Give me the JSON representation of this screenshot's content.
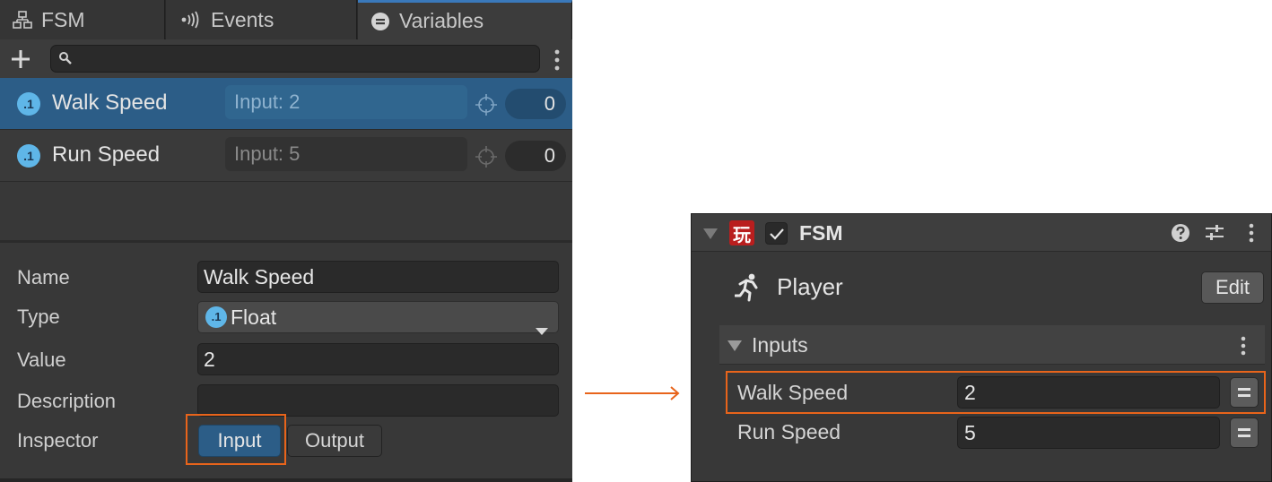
{
  "tabs": {
    "fsm": "FSM",
    "events": "Events",
    "variables": "Variables"
  },
  "search": {
    "value": "",
    "placeholder": ""
  },
  "variables": [
    {
      "name": "Walk Speed",
      "io": "Input: 2",
      "value": "0"
    },
    {
      "name": "Run Speed",
      "io": "Input: 5",
      "value": "0"
    }
  ],
  "float_badge": ".1",
  "properties": {
    "name_label": "Name",
    "name_value": "Walk Speed",
    "type_label": "Type",
    "type_value": "Float",
    "value_label": "Value",
    "value_value": "2",
    "description_label": "Description",
    "description_value": "",
    "inspector_label": "Inspector",
    "input_button": "Input",
    "output_button": "Output"
  },
  "component": {
    "logo": "玩",
    "title": "FSM",
    "owner": "Player",
    "edit_button": "Edit",
    "inputs_title": "Inputs",
    "inputs": [
      {
        "name": "Walk Speed",
        "value": "2"
      },
      {
        "name": "Run Speed",
        "value": "5"
      }
    ]
  },
  "colors": {
    "selection": "#2c5d87",
    "accent_tab": "#3a79bb",
    "highlight": "#e8641b",
    "float_badge": "#5fb6e8",
    "logo_red": "#b91e1e"
  },
  "icons": {
    "fsm_tab": "hierarchy-icon",
    "events_tab": "broadcast-icon",
    "variables_tab": "variables-icon",
    "add": "plus-icon",
    "search": "search-icon",
    "target": "target-icon",
    "help": "help-icon",
    "presets": "sliders-icon",
    "menu": "kebab-menu-icon",
    "player": "running-person-icon",
    "eq": "equals-icon"
  }
}
